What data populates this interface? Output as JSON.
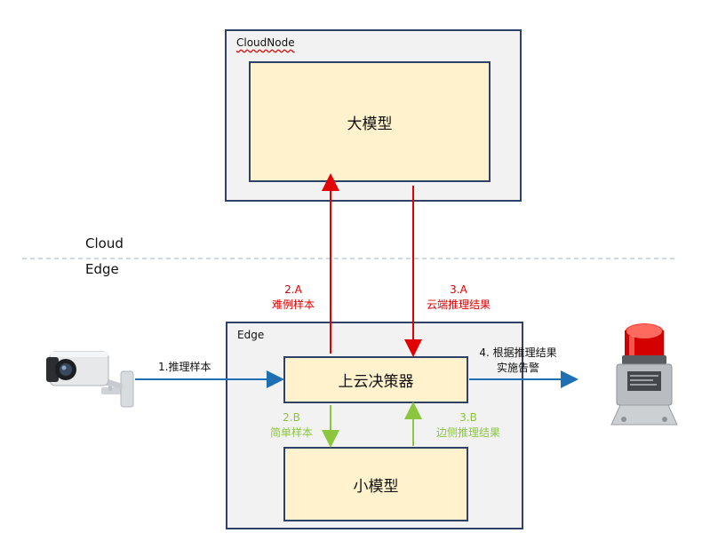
{
  "cloud_node": {
    "title": "CloudNode",
    "model": "大模型"
  },
  "regions": {
    "cloud": "Cloud",
    "edge": "Edge"
  },
  "edge_node": {
    "title": "Edge",
    "decider": "上云决策器",
    "model": "小模型"
  },
  "flows": {
    "step1": "1.推理样本",
    "step2a_num": "2.A",
    "step2a_text": "难例样本",
    "step3a_num": "3.A",
    "step3a_text": "云端推理结果",
    "step2b_num": "2.B",
    "step2b_text": "简单样本",
    "step3b_num": "3.B",
    "step3b_text": "边侧推理结果",
    "step4_line1": "4. 根据推理结果",
    "step4_line2": "实施告警"
  },
  "colors": {
    "red_arrow": "#e30000",
    "green_arrow": "#8cc63f",
    "blue_arrow": "#1f6fb5",
    "box_fill": "#fff2cc",
    "container_fill": "#f2f2f2",
    "border": "#2f4166"
  },
  "icons": {
    "camera": "security-camera-icon",
    "alarm": "warning-light-icon"
  }
}
